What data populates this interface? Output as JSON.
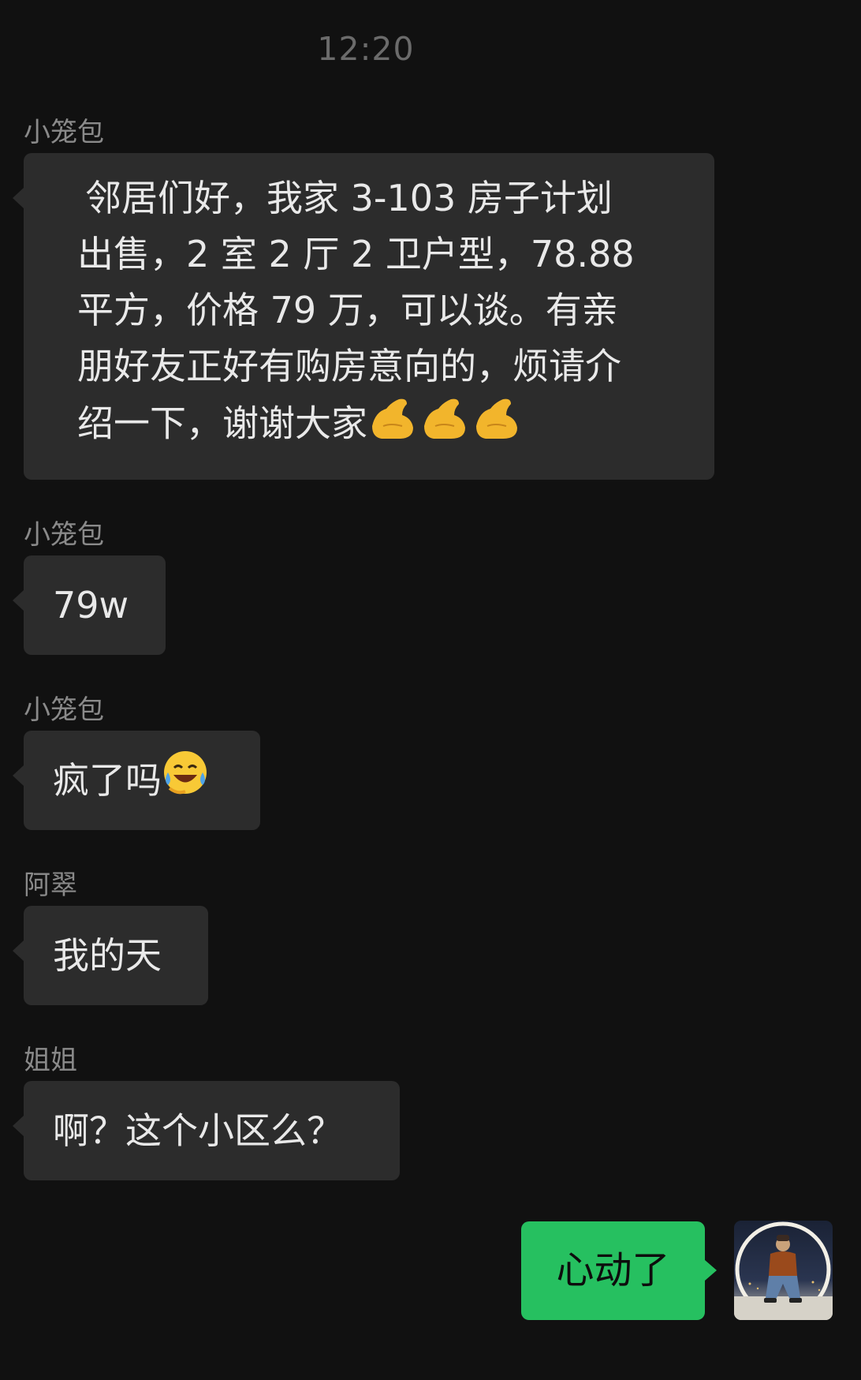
{
  "time": "12:20",
  "messages": [
    {
      "sender": "小笼包",
      "text": "邻居们好，我家 3-103 房子计划出售，2 室 2 厅 2 卫户型，78.88 平方，价格 79 万，可以谈。有亲朋好友正好有购房意向的，烦请介绍一下，谢谢大家",
      "emoji_trail": "🫴🫴🫴",
      "lines": [
        "邻居们好，我家 3-103 房子计划",
        "出售，2 室 2 厅 2 卫户型，78.88",
        "平方，价格 79 万，可以谈。有亲",
        "朋好友正好有购房意向的，烦请介",
        "绍一下，谢谢大家"
      ]
    },
    {
      "sender": "小笼包",
      "text": "79w"
    },
    {
      "sender": "小笼包",
      "text": "疯了吗",
      "emoji": "😭"
    },
    {
      "sender": "阿翠",
      "text": "我的天"
    },
    {
      "sender": "姐姐",
      "text": "啊？这个小区么？"
    }
  ],
  "my_message": {
    "text": "心动了"
  },
  "icons": {
    "avatar": "user-avatar-photo",
    "hands": "pinching-hand-icon",
    "laugh_cry": "crying-laughing-face-icon"
  }
}
